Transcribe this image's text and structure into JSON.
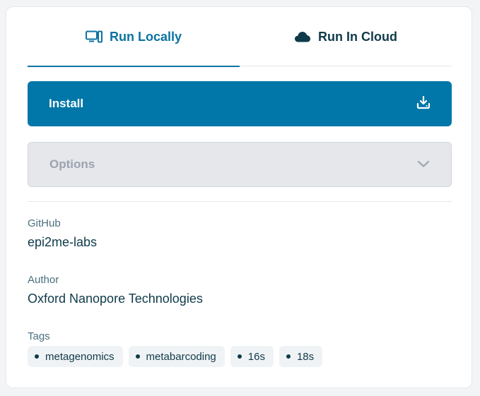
{
  "tabs": [
    {
      "label": "Run Locally",
      "icon": "desktop-icon",
      "active": true
    },
    {
      "label": "Run In Cloud",
      "icon": "cloud-icon",
      "active": false
    }
  ],
  "install": {
    "label": "Install",
    "icon": "download-icon"
  },
  "options": {
    "label": "Options",
    "icon": "chevron-down-icon"
  },
  "github": {
    "label": "GitHub",
    "value": "epi2me-labs"
  },
  "author": {
    "label": "Author",
    "value": "Oxford Nanopore Technologies"
  },
  "tags": {
    "label": "Tags",
    "items": [
      "metagenomics",
      "metabarcoding",
      "16s",
      "18s"
    ]
  },
  "colors": {
    "accent": "#0077a8",
    "text_dark": "#0f3a4a",
    "muted": "#9ca3af"
  }
}
